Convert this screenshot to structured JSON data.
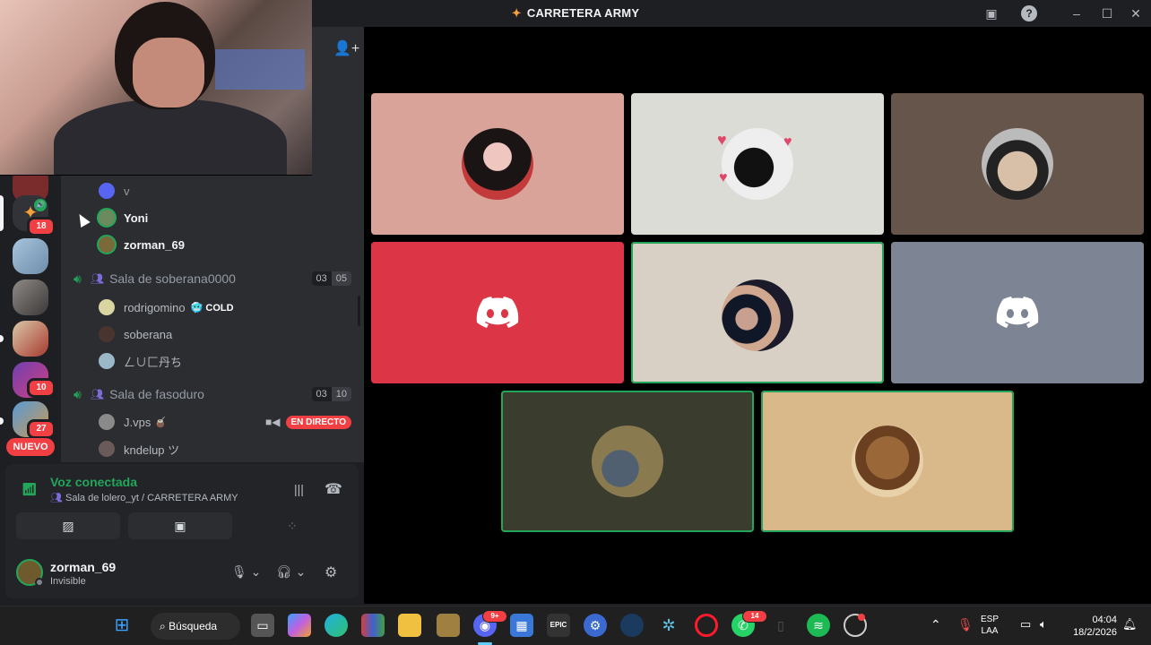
{
  "window": {
    "title": "CARRETERA ARMY"
  },
  "servers": [
    {
      "badge": "18"
    },
    {
      "badge": ""
    },
    {
      "badge": ""
    },
    {
      "badge": ""
    },
    {
      "badge": "10"
    },
    {
      "badge": "27"
    }
  ],
  "rail": {
    "new_label": "NUEVO"
  },
  "channel_list": {
    "top_users": [
      {
        "name": "v"
      },
      {
        "name": "Yoni"
      },
      {
        "name": "zorman_69"
      }
    ],
    "voice_channels": [
      {
        "name": "Sala de soberana0000",
        "count": "03",
        "limit": "05",
        "users": [
          {
            "name": "rodrigomino",
            "tag": "COLD",
            "tag_emoji": "🥶"
          },
          {
            "name": "soberana"
          },
          {
            "name": "ㄥ∪匚丹ち"
          }
        ]
      },
      {
        "name": "Sala de fasoduro",
        "count": "03",
        "limit": "10",
        "users": [
          {
            "name": "J.vps",
            "emoji": "🧉",
            "live": "EN DIRECTO"
          },
          {
            "name": "kndelup ツ"
          }
        ]
      }
    ]
  },
  "voice_panel": {
    "status": "Voz conectada",
    "location": "Sala de lolero_yt / CARRETERA ARMY"
  },
  "user_panel": {
    "name": "zorman_69",
    "status": "Invisible"
  },
  "taskbar": {
    "search_label": "Búsqueda",
    "discord_badge": "9+",
    "whatsapp_badge": "14",
    "epic_label": "EPIC",
    "language": "ESP",
    "layout": "LAA",
    "time": "04:04",
    "date": "18/2/2026"
  },
  "colors": {
    "speaking": "#23a55a",
    "danger": "#f23f43",
    "background": "#1e1f22",
    "sidebar": "#2b2d31"
  }
}
